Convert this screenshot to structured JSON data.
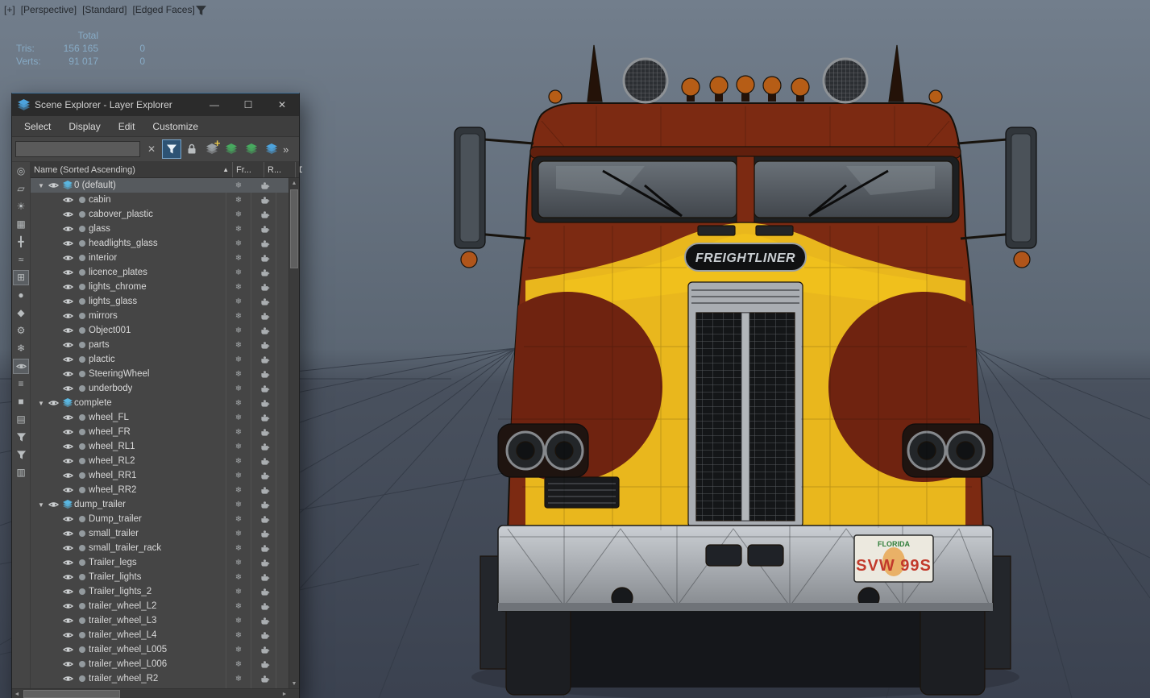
{
  "colors": {
    "accent_blue": "#3e6d96",
    "truck_red": "#7c2a12",
    "truck_yellow": "#e9b71d",
    "plate_red": "#c23a2c",
    "stats_text": "#87abc6"
  },
  "icons": {
    "minimize": "—",
    "maximize": "☐",
    "close": "✕",
    "clear_search": "✕",
    "overflow": "»",
    "sort_ascending": "▲",
    "expand_arrow": "▼",
    "snowflake": "❄",
    "scroll_up": "▲",
    "scroll_down": "▼",
    "scroll_left": "◄",
    "scroll_right": "►",
    "create_layer_plus": "+"
  },
  "viewport": {
    "label_parts": [
      "[+]",
      "[Perspective]",
      "[Standard]",
      "[Edged Faces]"
    ],
    "stats": {
      "total_label": "Total",
      "tris_label": "Tris:",
      "tris_total": "156 165",
      "tris_selected": "0",
      "verts_label": "Verts:",
      "verts_total": "91 017",
      "verts_selected": "0"
    },
    "truck": {
      "brand_badge": "FREIGHTLINER",
      "license_plate": {
        "state": "FLORIDA",
        "number": "SVW 99S"
      }
    }
  },
  "scene_explorer": {
    "title": "Scene Explorer - Layer Explorer",
    "menus": [
      "Select",
      "Display",
      "Edit",
      "Customize"
    ],
    "search_value": "",
    "columns": [
      "Name (Sorted Ascending)",
      "Fr...",
      "R...",
      "Displ"
    ],
    "left_toolbar": [
      {
        "name": "display-all-icon",
        "glyph": "◎"
      },
      {
        "name": "display-shapes-icon",
        "glyph": "▱"
      },
      {
        "name": "display-lights-icon",
        "glyph": "☀"
      },
      {
        "name": "display-cameras-icon",
        "glyph": "▦"
      },
      {
        "name": "display-helpers-icon",
        "glyph": "╋"
      },
      {
        "name": "display-spacewarps-icon",
        "glyph": "≈"
      },
      {
        "name": "display-geometry-icon",
        "glyph": "⊞",
        "active": true
      },
      {
        "name": "display-particles-icon",
        "glyph": "●"
      },
      {
        "name": "display-bones-icon",
        "glyph": "◆"
      },
      {
        "name": "settings-gear-icon",
        "glyph": "⚙"
      },
      {
        "name": "freeze-toggle-icon",
        "glyph": "❄"
      },
      {
        "name": "visibility-eye-icon",
        "svg": "i-eye",
        "active": true
      },
      {
        "name": "list-view-icon",
        "glyph": "≡"
      },
      {
        "name": "swatch-icon",
        "glyph": "■"
      },
      {
        "name": "notes-icon",
        "glyph": "▤"
      },
      {
        "name": "filter-clear-icon",
        "svg": "i-funnel"
      },
      {
        "name": "filter-icon",
        "svg": "i-funnel"
      },
      {
        "name": "folder-icon",
        "glyph": "▥"
      }
    ],
    "tree": [
      {
        "name": "0 (default)",
        "type": "layer",
        "selected": true
      },
      {
        "name": "cabin",
        "type": "object"
      },
      {
        "name": "cabover_plastic",
        "type": "object"
      },
      {
        "name": "glass",
        "type": "object"
      },
      {
        "name": "headlights_glass",
        "type": "object"
      },
      {
        "name": "interior",
        "type": "object"
      },
      {
        "name": "licence_plates",
        "type": "object"
      },
      {
        "name": "lights_chrome",
        "type": "object"
      },
      {
        "name": "lights_glass",
        "type": "object"
      },
      {
        "name": "mirrors",
        "type": "object"
      },
      {
        "name": "Object001",
        "type": "object"
      },
      {
        "name": "parts",
        "type": "object"
      },
      {
        "name": "plactic",
        "type": "object"
      },
      {
        "name": "SteeringWheel",
        "type": "object"
      },
      {
        "name": "underbody",
        "type": "object"
      },
      {
        "name": "complete",
        "type": "layer"
      },
      {
        "name": "wheel_FL",
        "type": "object"
      },
      {
        "name": "wheel_FR",
        "type": "object"
      },
      {
        "name": "wheel_RL1",
        "type": "object"
      },
      {
        "name": "wheel_RL2",
        "type": "object"
      },
      {
        "name": "wheel_RR1",
        "type": "object"
      },
      {
        "name": "wheel_RR2",
        "type": "object"
      },
      {
        "name": "dump_trailer",
        "type": "layer"
      },
      {
        "name": "Dump_trailer",
        "type": "object"
      },
      {
        "name": "small_trailer",
        "type": "object"
      },
      {
        "name": "small_trailer_rack",
        "type": "object"
      },
      {
        "name": "Trailer_legs",
        "type": "object"
      },
      {
        "name": "Trailer_lights",
        "type": "object"
      },
      {
        "name": "Trailer_lights_2",
        "type": "object"
      },
      {
        "name": "trailer_wheel_L2",
        "type": "object"
      },
      {
        "name": "trailer_wheel_L3",
        "type": "object"
      },
      {
        "name": "trailer_wheel_L4",
        "type": "object"
      },
      {
        "name": "trailer_wheel_L005",
        "type": "object"
      },
      {
        "name": "trailer_wheel_L006",
        "type": "object"
      },
      {
        "name": "trailer_wheel_R2",
        "type": "object"
      }
    ]
  }
}
